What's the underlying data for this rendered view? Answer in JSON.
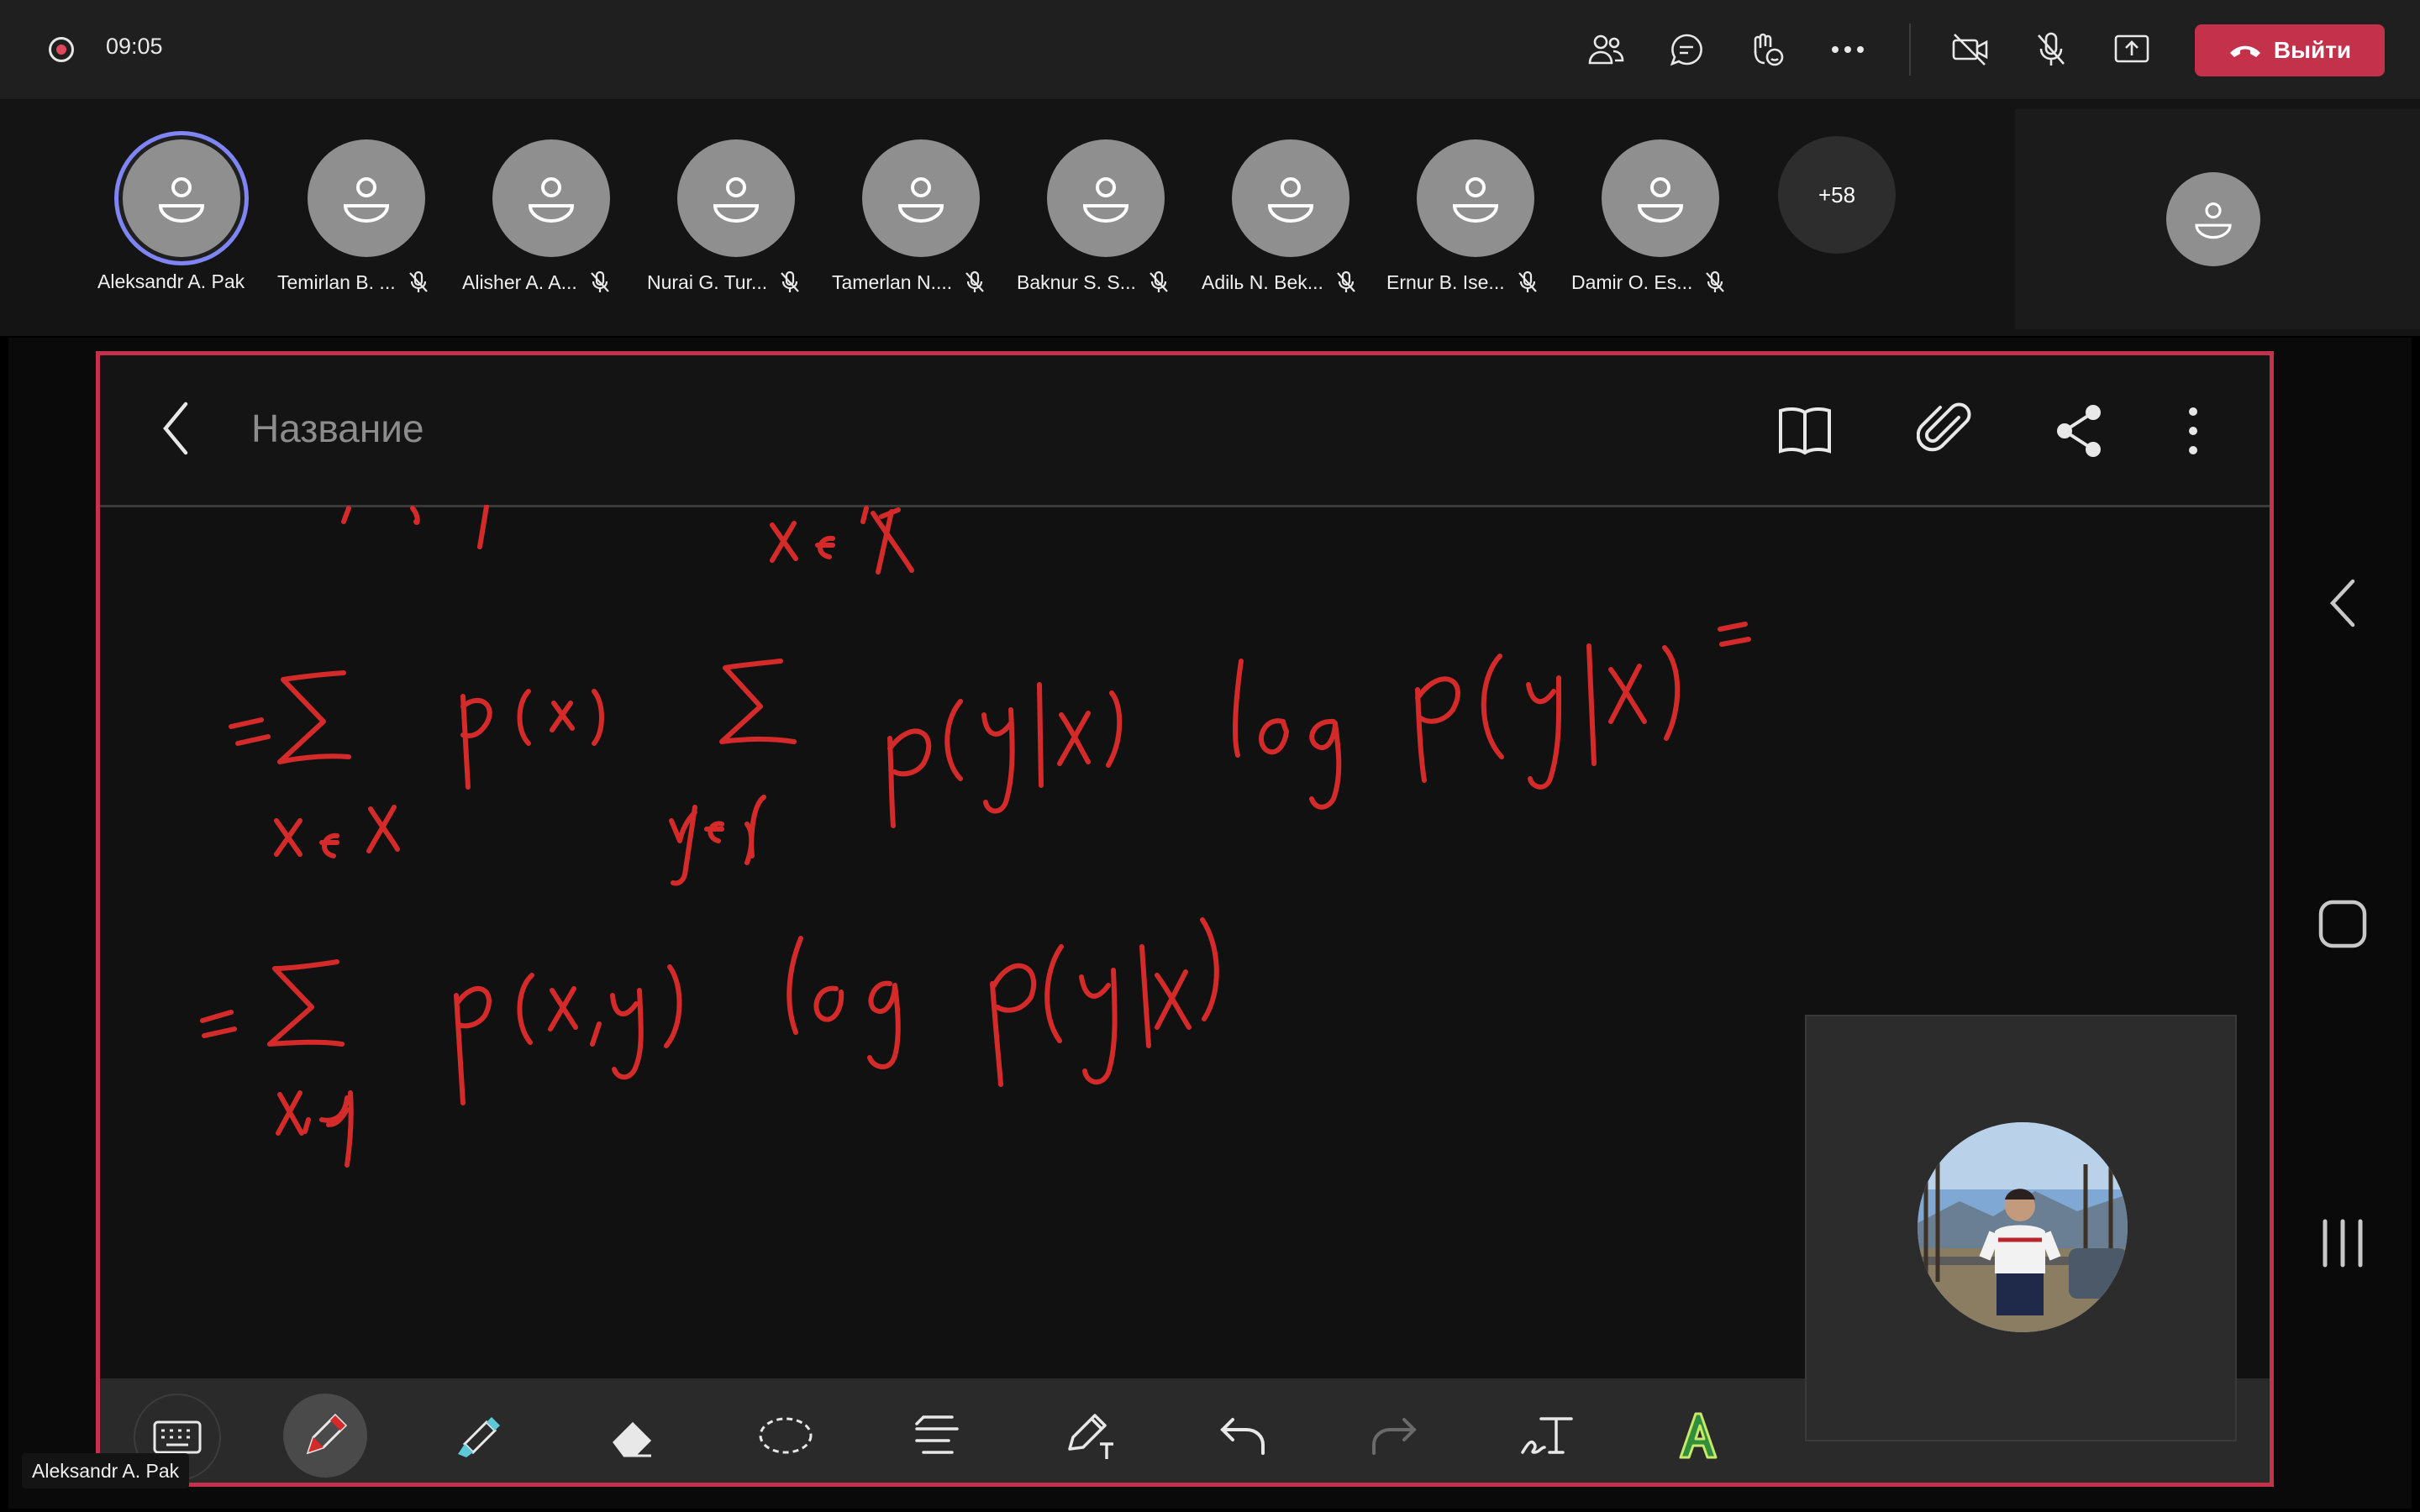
{
  "toolbar": {
    "recording_icon": "record-icon",
    "timer": "09:05",
    "leave_label": "Выйти",
    "icons": [
      "people-icon",
      "chat-icon",
      "reactions-icon",
      "more-icon",
      "camera-off-icon",
      "mic-off-icon",
      "share-screen-icon",
      "hangup-icon"
    ],
    "leave_color": "#c4314b"
  },
  "participants": [
    {
      "name": "Aleksandr A. Pak",
      "muted": false,
      "speaking": true
    },
    {
      "name": "Temirlan B. ...",
      "muted": true
    },
    {
      "name": "Alisher A. A...",
      "muted": true
    },
    {
      "name": "Nurai G. Tur...",
      "muted": true
    },
    {
      "name": "Tamerlan N....",
      "muted": true
    },
    {
      "name": "Baknur S. S...",
      "muted": true
    },
    {
      "name": "Adilь N. Bek...",
      "muted": true
    },
    {
      "name": "Ernur B. Ise...",
      "muted": true
    },
    {
      "name": "Damir O. Es...",
      "muted": true
    }
  ],
  "more_participants": "+58",
  "shared_screen": {
    "note_title": "Название",
    "header_icons": [
      "back-icon",
      "book-icon",
      "attach-icon",
      "share-icon",
      "kebab-menu-icon"
    ],
    "ink_color": "#d42a2a",
    "tools": [
      "keyboard-icon",
      "pen-icon",
      "highlighter-icon",
      "eraser-icon",
      "lasso-icon",
      "align-text-icon",
      "pen-settings-icon",
      "undo-icon",
      "redo-icon",
      "handwriting-to-text-icon",
      "text-style-icon"
    ],
    "selected_tool": "pen-icon",
    "android_nav": [
      "nav-back-icon",
      "nav-home-icon",
      "nav-recents-icon"
    ]
  },
  "presenter_label": "Aleksandr A. Pak"
}
